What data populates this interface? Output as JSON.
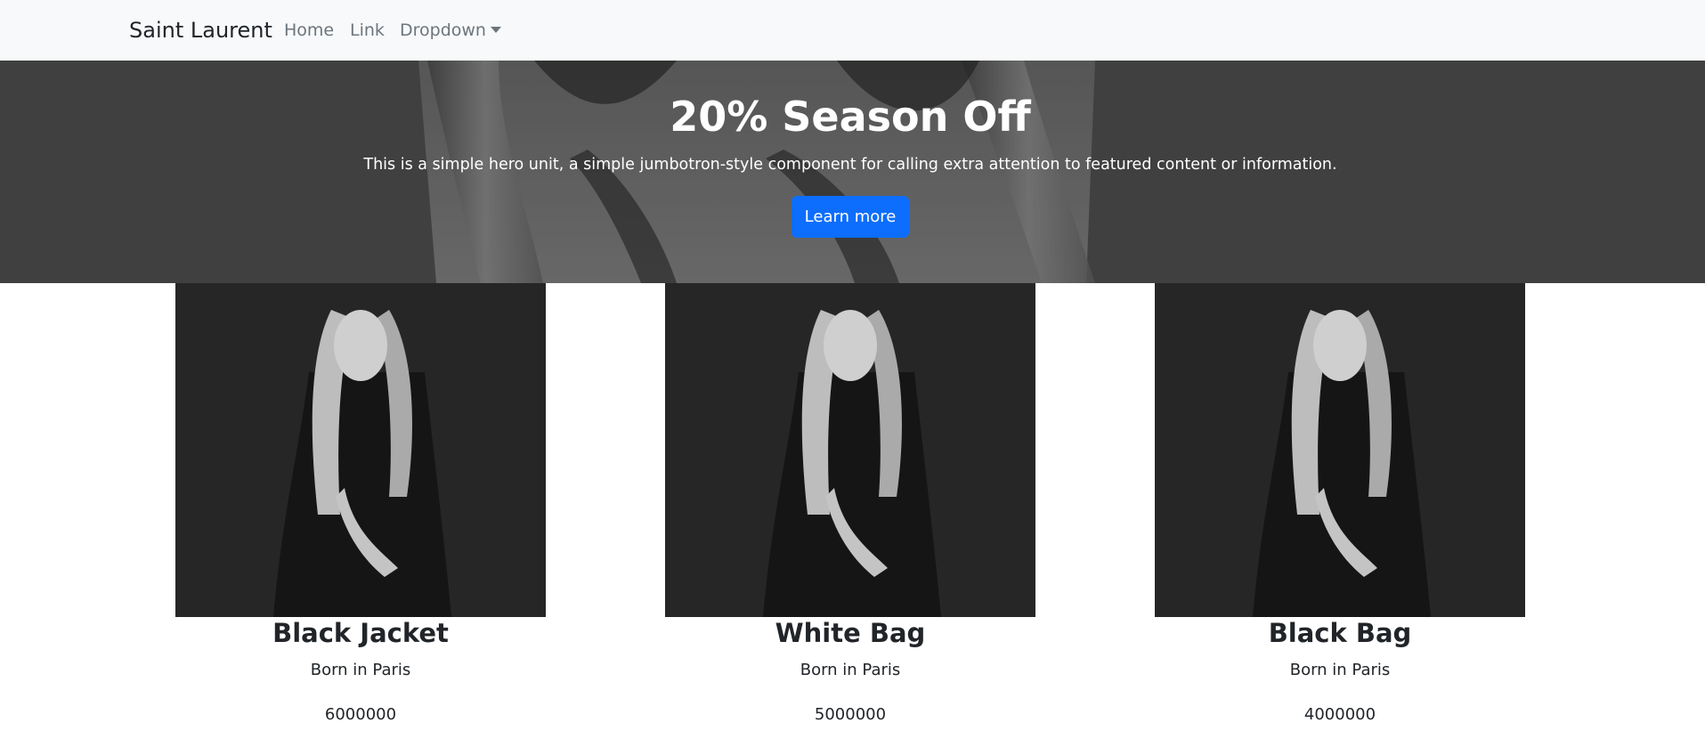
{
  "navbar": {
    "brand": "Saint Laurent",
    "links": [
      {
        "label": "Home"
      },
      {
        "label": "Link"
      },
      {
        "label": "Dropdown"
      }
    ]
  },
  "hero": {
    "title": "20% Season Off",
    "lead": "This is a simple hero unit, a simple jumbotron-style component for calling extra attention to featured content or information.",
    "button_label": "Learn more"
  },
  "products": [
    {
      "name": "Black Jacket",
      "origin": "Born in Paris",
      "price": "6000000"
    },
    {
      "name": "White Bag",
      "origin": "Born in Paris",
      "price": "5000000"
    },
    {
      "name": "Black Bag",
      "origin": "Born in Paris",
      "price": "4000000"
    }
  ],
  "colors": {
    "navbar_bg": "#f8f9fa",
    "link": "#6c757d",
    "primary_button": "#0d6efd",
    "hero_overlay": "#5a5a5a"
  },
  "icons": {
    "dropdown": "caret-down-icon"
  }
}
